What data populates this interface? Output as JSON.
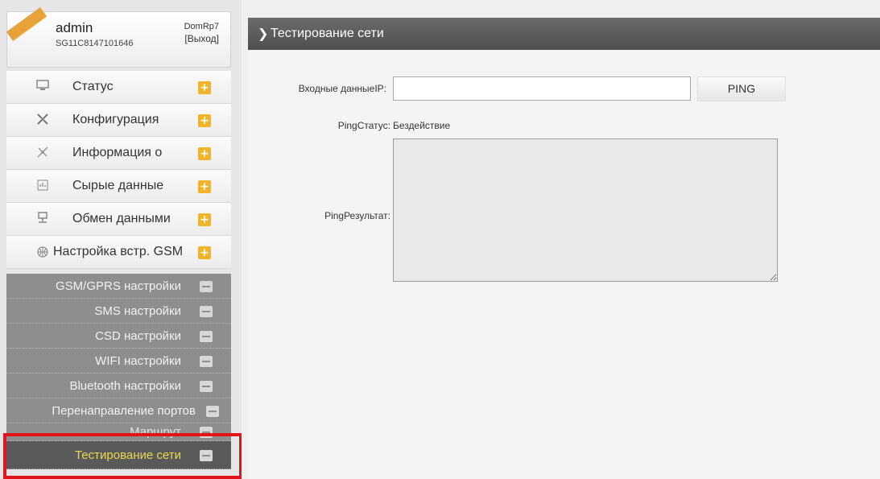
{
  "user": {
    "name": "admin",
    "serial": "SG11C8147101646",
    "host": "DomRp7",
    "logout_label": "[Выход]"
  },
  "menu": [
    {
      "label": "Статус",
      "icon": "monitor-icon"
    },
    {
      "label": "Конфигурация",
      "icon": "tools-icon"
    },
    {
      "label": "Информация о",
      "icon": "info-tools-icon"
    },
    {
      "label": "Сырые данные",
      "icon": "raw-data-icon"
    },
    {
      "label": "Обмен данными",
      "icon": "network-icon"
    },
    {
      "label": "Настройка встр. GSM",
      "icon": "globe-icon"
    }
  ],
  "submenu": [
    {
      "label": "GSM/GPRS настройки"
    },
    {
      "label": "SMS настройки"
    },
    {
      "label": "CSD настройки"
    },
    {
      "label": "WIFI настройки"
    },
    {
      "label": "Bluetooth настройки"
    },
    {
      "label": "Перенаправление портов"
    },
    {
      "label": "Маршрут"
    },
    {
      "label": "Тестирование сети"
    }
  ],
  "page": {
    "title": "Тестирование сети"
  },
  "form": {
    "ip_label": "Входные данныеIP:",
    "ip_value": "",
    "ping_button": "PING",
    "status_label": "PingСтатус:",
    "status_value": "Бездействие",
    "result_label": "PingРезультат:",
    "result_value": ""
  },
  "colors": {
    "accent_orange": "#f0b32a",
    "header_dark": "#5a5a5a",
    "active_text": "#e9d84a",
    "highlight_red": "#e1151b"
  }
}
